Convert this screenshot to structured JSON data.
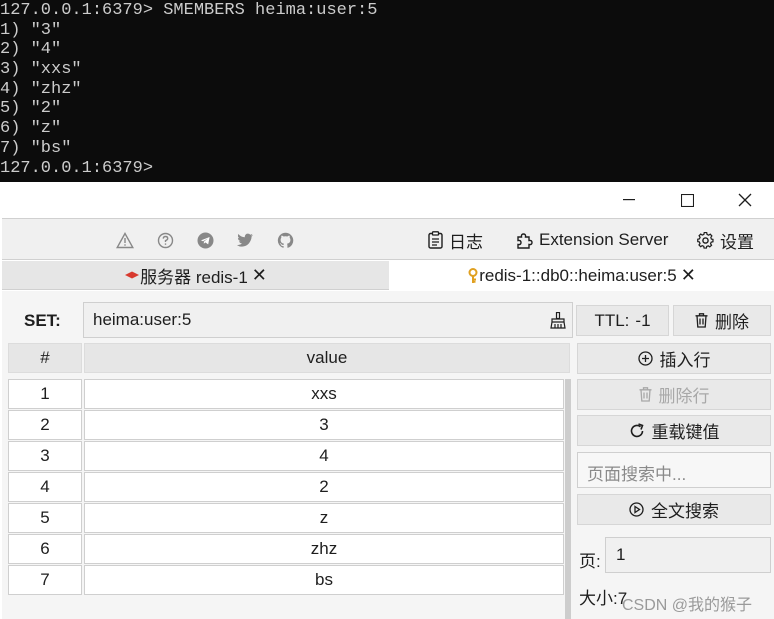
{
  "terminal": {
    "lines": [
      "127.0.0.1:6379> SMEMBERS heima:user:5",
      "1) \"3\"",
      "2) \"4\"",
      "3) \"xxs\"",
      "4) \"zhz\"",
      "5) \"2\"",
      "6) \"z\"",
      "7) \"bs\"",
      "127.0.0.1:6379>"
    ]
  },
  "toolbar": {
    "log_label": "日志",
    "extension_label": "Extension Server",
    "settings_label": "设置"
  },
  "tabs": [
    {
      "label": "服务器 redis-1",
      "close": "✕"
    },
    {
      "label": "redis-1::db0::heima:user:5",
      "close": "✕"
    }
  ],
  "editor": {
    "type_label": "SET:",
    "key_value": "heima:user:5",
    "ttl_label": "TTL:",
    "ttl_value": "-1",
    "delete_label": "删除",
    "columns": [
      "#",
      "value"
    ],
    "rows": [
      {
        "index": "1",
        "value": "xxs"
      },
      {
        "index": "2",
        "value": "3"
      },
      {
        "index": "3",
        "value": "4"
      },
      {
        "index": "4",
        "value": "2"
      },
      {
        "index": "5",
        "value": "z"
      },
      {
        "index": "6",
        "value": "zhz"
      },
      {
        "index": "7",
        "value": "bs"
      }
    ],
    "insert_row_label": "插入行",
    "delete_row_label": "删除行",
    "reload_label": "重载键值",
    "page_search_placeholder": "页面搜索中...",
    "fulltext_search_label": "全文搜索",
    "page_label": "页:",
    "page_value": "1",
    "size_label": "大小:",
    "size_value": "7"
  },
  "watermark": "CSDN @我的猴子",
  "colors": {
    "terminal_bg": "#0c0c0c",
    "terminal_fg": "#cccccc",
    "server_icon": "#d83a2f",
    "key_icon": "#e0a020"
  }
}
